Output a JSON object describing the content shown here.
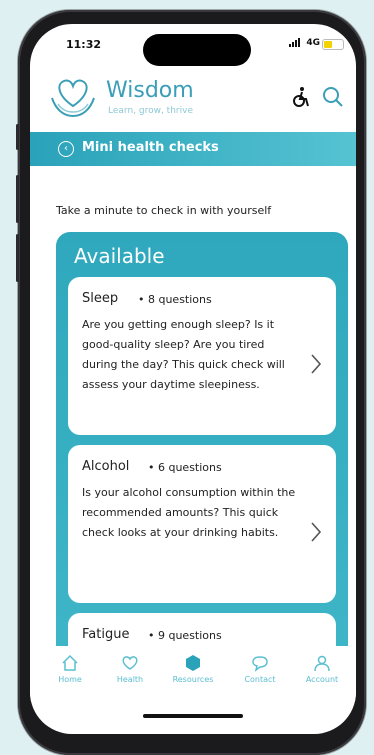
{
  "status_bar": {
    "time": "11:32",
    "network": "4G"
  },
  "header": {
    "app_name": "Wisdom",
    "tagline": "Learn, grow, thrive"
  },
  "banner": {
    "title": "Mini health checks"
  },
  "intro": "Take a minute to check in with yourself",
  "available": {
    "heading": "Available",
    "cards": [
      {
        "title": "Sleep",
        "questions": "• 8 questions",
        "description": "Are you getting enough sleep? Is it good-quality sleep? Are you tired during the day? This quick check will assess your daytime sleepiness."
      },
      {
        "title": "Alcohol",
        "questions": "• 6 questions",
        "description": "Is your alcohol consumption within the recommended amounts? This quick check looks at your drinking habits."
      },
      {
        "title": "Fatigue",
        "questions": "• 9 questions",
        "description": ""
      }
    ]
  },
  "tabbar": {
    "home": "Home",
    "health": "Health",
    "resources": "Resources",
    "contact": "Contact",
    "account": "Account"
  },
  "colors": {
    "accent": "#3a9fb6",
    "banner": "#2aa2b9",
    "card_bg": "#ffffff",
    "tab_label": "#5bbfd0"
  }
}
